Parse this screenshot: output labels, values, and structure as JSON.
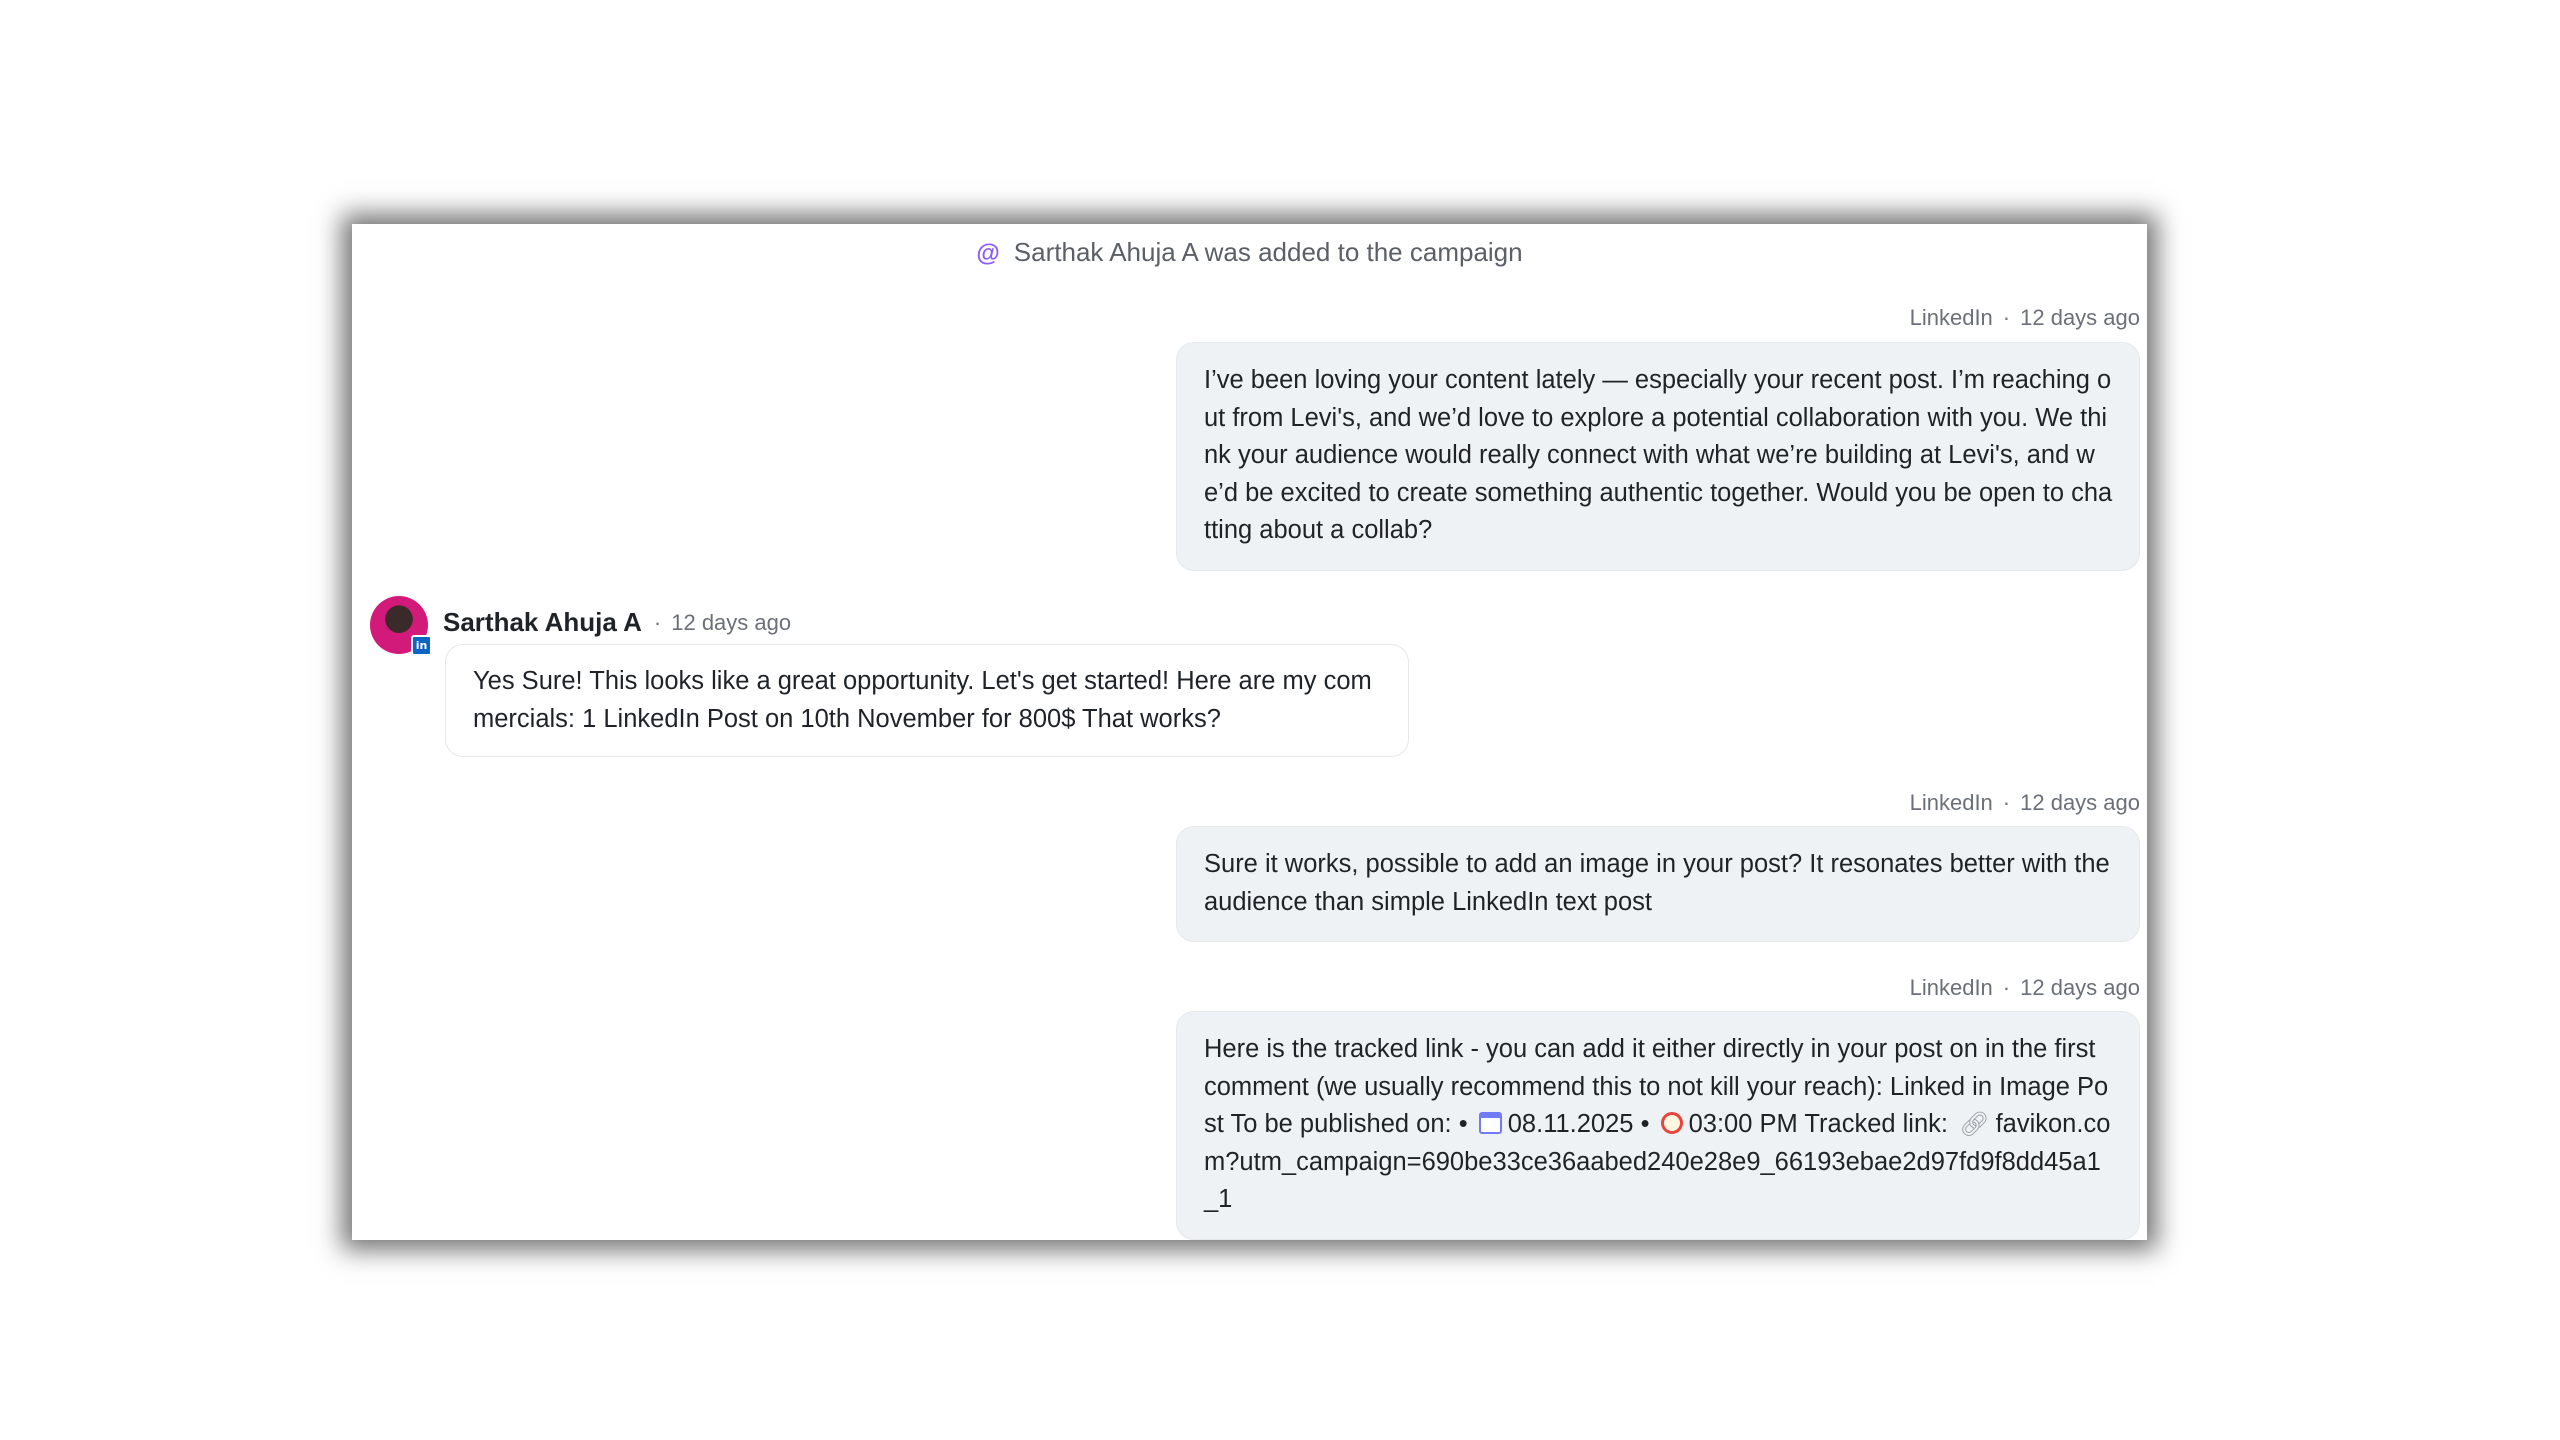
{
  "system_note": {
    "icon": "at-icon",
    "text": "Sarthak Ahuja A was added to the campaign"
  },
  "messages": [
    {
      "direction": "outgoing",
      "channel": "LinkedIn",
      "time": "12 days ago",
      "text": "I’ve been loving your content lately — especially your recent post. I’m reaching out from Levi's, and we’d love to explore a potential collaboration with you. We think your audience would really connect with what we’re building at Levi's, and we’d be excited to create something authentic together. Would you be open to chatting about a collab?"
    },
    {
      "direction": "incoming",
      "sender": "Sarthak Ahuja A",
      "time": "12 days ago",
      "avatar_badge": "in",
      "text": "Yes Sure! This looks like a great opportunity. Let's get started! Here are my commercials: 1 LinkedIn Post on 10th November for 800$ That works?"
    },
    {
      "direction": "outgoing",
      "channel": "LinkedIn",
      "time": "12 days ago",
      "text": "Sure it works, possible to add an image in your post? It resonates better with the audience than simple LinkedIn text post"
    },
    {
      "direction": "outgoing",
      "channel": "LinkedIn",
      "time": "12 days ago",
      "text_part1": "Here is the tracked link - you can add it either directly in your post on in the first comment (we usually recommend this to not kill your reach): Linked in Image Post To be published on: •",
      "date": "08.11.2025",
      "bullet": "•",
      "time_value": "03:00 PM",
      "text_part2": "Tracked link:",
      "link": "favikon.com?utm_campaign=690be33ce36aabed240e28e9_66193ebae2d97fd9f8dd45a1_1"
    }
  ],
  "separator": "·"
}
